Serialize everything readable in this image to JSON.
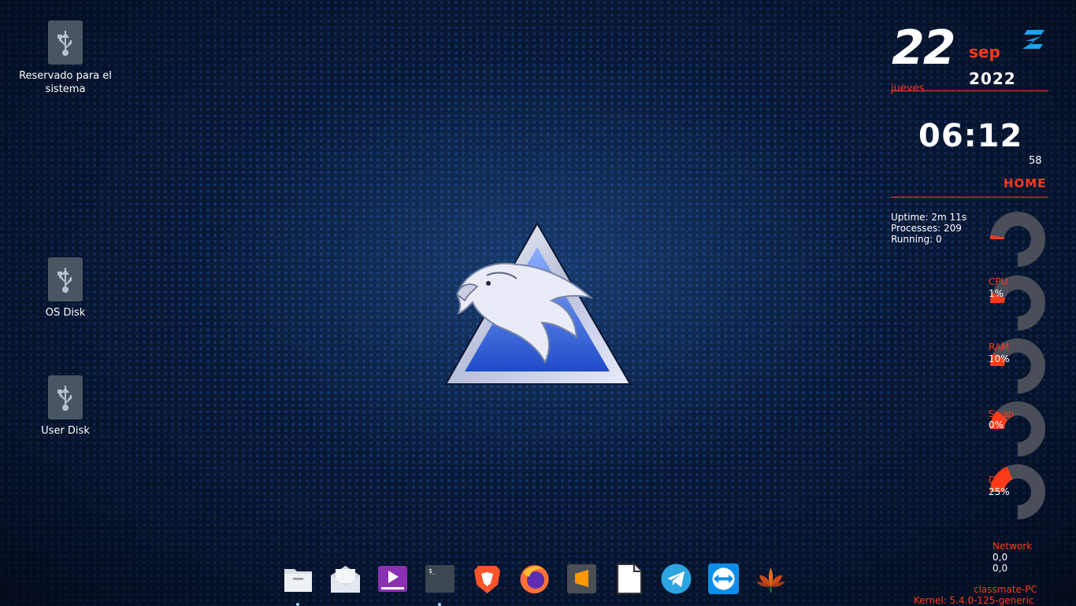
{
  "desktop": {
    "icons": [
      {
        "label": "Reservado para el\nsistema",
        "icon": "usb-drive-icon"
      },
      {
        "label": "OS Disk",
        "icon": "usb-drive-icon"
      },
      {
        "label": "User Disk",
        "icon": "usb-drive-icon"
      }
    ]
  },
  "conky": {
    "day": "22",
    "month": "sep",
    "year": "2022",
    "weekday": "jueves",
    "time": "06:12",
    "seconds": "58",
    "section": "HOME",
    "uptime": "Uptime: 2m 11s",
    "processes": "Processes: 209",
    "running": "Running: 0",
    "gauges": [
      {
        "label": "",
        "value": "",
        "fraction": 0.03
      },
      {
        "label": "CPU",
        "value": "1%",
        "fraction": 0.08
      },
      {
        "label": "RAM",
        "value": "10%",
        "fraction": 0.1
      },
      {
        "label": "Swap",
        "value": "0%",
        "fraction": 0.15
      },
      {
        "label": "Disk",
        "value": "25%",
        "fraction": 0.25
      }
    ],
    "network_label": "Network",
    "net_down": "0,0",
    "net_up": "0,0",
    "hostname": "classmate-PC",
    "kernel": "Kernel: 5.4.0-125-generic",
    "accent_color": "#ff3b1a"
  },
  "dock": {
    "apps": [
      {
        "name": "files-icon",
        "running": true
      },
      {
        "name": "mail-icon",
        "running": false
      },
      {
        "name": "video-player-icon",
        "running": false
      },
      {
        "name": "terminal-icon",
        "running": true
      },
      {
        "name": "brave-browser-icon",
        "running": false
      },
      {
        "name": "firefox-icon",
        "running": false
      },
      {
        "name": "sublime-text-icon",
        "running": false
      },
      {
        "name": "libreoffice-icon",
        "running": false
      },
      {
        "name": "telegram-icon",
        "running": false
      },
      {
        "name": "teamviewer-icon",
        "running": false
      },
      {
        "name": "lotus-icon",
        "running": false
      }
    ]
  }
}
